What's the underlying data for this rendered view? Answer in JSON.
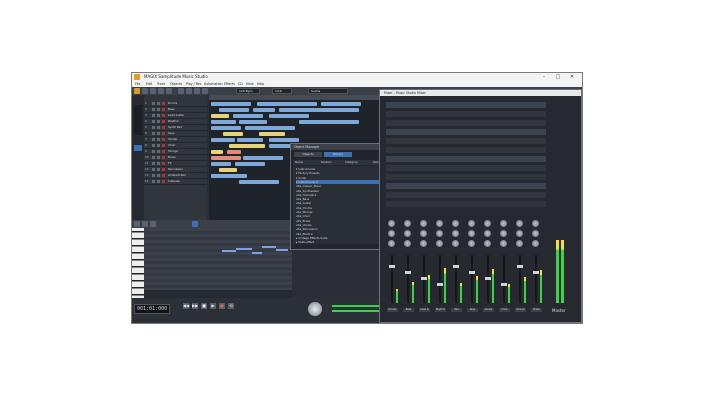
{
  "window": {
    "title": "MAGIX Samplitude Music Studio",
    "controls": {
      "minimize": "–",
      "maximize": "□",
      "close": "✕"
    }
  },
  "menu": [
    "File",
    "Edit",
    "Track",
    "Objects",
    "Play / Rec",
    "Automation",
    "Effects",
    "CD",
    "View",
    "Help"
  ],
  "toolbar": {
    "tempo_field": "120 Bpm",
    "snap_field": "1/16",
    "search_field": "Suche"
  },
  "tracks": [
    {
      "num": "1",
      "name": "Drums"
    },
    {
      "num": "2",
      "name": "Bass"
    },
    {
      "num": "3",
      "name": "Lead Guitar"
    },
    {
      "num": "4",
      "name": "Rhythm"
    },
    {
      "num": "5",
      "name": "Synth Pad"
    },
    {
      "num": "6",
      "name": "Keys"
    },
    {
      "num": "7",
      "name": "Vocals"
    },
    {
      "num": "8",
      "name": "Choir"
    },
    {
      "num": "9",
      "name": "Strings"
    },
    {
      "num": "10",
      "name": "Brass"
    },
    {
      "num": "11",
      "name": "FX"
    },
    {
      "num": "12",
      "name": "Percussion"
    },
    {
      "num": "13",
      "name": "Ambient Pad"
    },
    {
      "num": "14",
      "name": "Subbass"
    }
  ],
  "transport": {
    "position": "001:01:000",
    "play": "▶",
    "stop": "■",
    "record": "●",
    "rewind": "◀◀",
    "forward": "▶▶",
    "loop": "⟲"
  },
  "object_manager": {
    "title": "Object Manager",
    "tabs": [
      "Objects",
      "Library"
    ],
    "columns": [
      "Name",
      "Position",
      "Category",
      "Recording",
      "Favorites"
    ],
    "nodes": [
      {
        "label": "▾ Instruments",
        "selected": false
      },
      {
        "label": "▾ Factory Presets",
        "selected": false
      },
      {
        "label": "▾ Audio",
        "selected": false
      },
      {
        "label": "▾ Instruments 2",
        "selected": true
      },
      {
        "label": "   vita_Classic_Piano",
        "selected": false
      },
      {
        "label": "   vita_Synthesizer",
        "selected": false
      },
      {
        "label": "   vita_Orchestra",
        "selected": false
      },
      {
        "label": "   vita_Bass",
        "selected": false
      },
      {
        "label": "   vita_Guitar",
        "selected": false
      },
      {
        "label": "   vita_Drums",
        "selected": false
      },
      {
        "label": "   vita_Strings",
        "selected": false
      },
      {
        "label": "   vita_Choir",
        "selected": false
      },
      {
        "label": "   vita_Brass",
        "selected": false
      },
      {
        "label": "   vita_Vocals",
        "selected": false
      },
      {
        "label": "   vita_Percussion",
        "selected": false
      },
      {
        "label": "   vita_Electric",
        "selected": false
      },
      {
        "label": "▸ Vintage Effects Suite",
        "selected": false
      },
      {
        "label": "▸ Multi-effect",
        "selected": false
      }
    ]
  },
  "mixer": {
    "title": "Mixer - Music Studio Mixer",
    "master_label": "Master",
    "channels": [
      "Drums",
      "Bass",
      "Lead G",
      "Rhythm",
      "Pad",
      "Keys",
      "Vocals",
      "Choir",
      "Strings",
      "Brass"
    ]
  },
  "colors": {
    "accent": "#3c6fb3",
    "clip_blue": "#7da8d8",
    "clip_yellow": "#e6d37a",
    "meter_green": "#39d34a"
  }
}
